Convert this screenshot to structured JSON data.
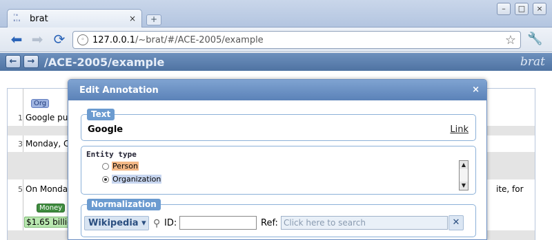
{
  "browser": {
    "tab_title": "brat",
    "tab_close": "×",
    "new_tab": "+",
    "window_buttons": [
      "–",
      "□",
      "×"
    ],
    "url_host": "127.0.0.1",
    "url_path": "/~brat/#/ACE-2005/example"
  },
  "brat": {
    "path": "/ACE-2005/example",
    "logo": "brat",
    "prev": "←",
    "next": "→"
  },
  "document": {
    "lines": [
      {
        "num": "1",
        "text": "Google pu"
      },
      {
        "num": "3",
        "text": "Monday, C"
      },
      {
        "num": "5",
        "text": "On Monda",
        "tail": "ite, for"
      }
    ],
    "org_label": "Org",
    "money_label": "Money",
    "money_text": "$1.65 billio"
  },
  "dialog": {
    "title": "Edit Annotation",
    "close": "×",
    "text_legend": "Text",
    "text_value": "Google",
    "link_label": "Link",
    "entity_type_heading": "Entity type",
    "entity_types": [
      {
        "label": "Person",
        "checked": false
      },
      {
        "label": "Organization",
        "checked": true
      }
    ],
    "normalization_legend": "Normalization",
    "norm_db": "Wikipedia ▾",
    "id_label": "ID:",
    "id_value": "",
    "ref_label": "Ref:",
    "ref_placeholder": "Click here to search",
    "clear": "✕"
  }
}
